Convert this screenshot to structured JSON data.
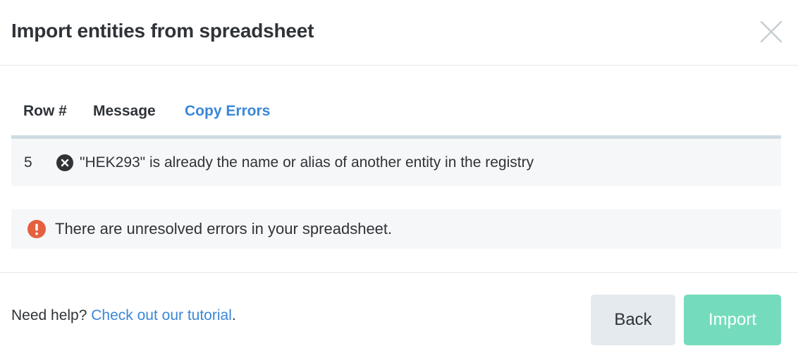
{
  "dialog": {
    "title": "Import entities from spreadsheet",
    "close_icon": "close-icon"
  },
  "errors_table": {
    "columns": {
      "row_label": "Row #",
      "message_label": "Message",
      "copy_label": "Copy Errors"
    },
    "rows": [
      {
        "row": "5",
        "icon": "error-circle-x-icon",
        "message": "\"HEK293\" is already the name or alias of another entity in the registry"
      }
    ]
  },
  "alert": {
    "icon": "exclamation-circle-icon",
    "text": "There are unresolved errors in your spreadsheet."
  },
  "footer": {
    "help_prefix": "Need help? ",
    "help_link": "Check out our tutorial",
    "help_suffix": ".",
    "back_label": "Back",
    "import_label": "Import"
  },
  "colors": {
    "link": "#3a87d8",
    "error_red": "#e5603f",
    "import_disabled": "#74dcbd",
    "back_bg": "#e4eaee"
  }
}
